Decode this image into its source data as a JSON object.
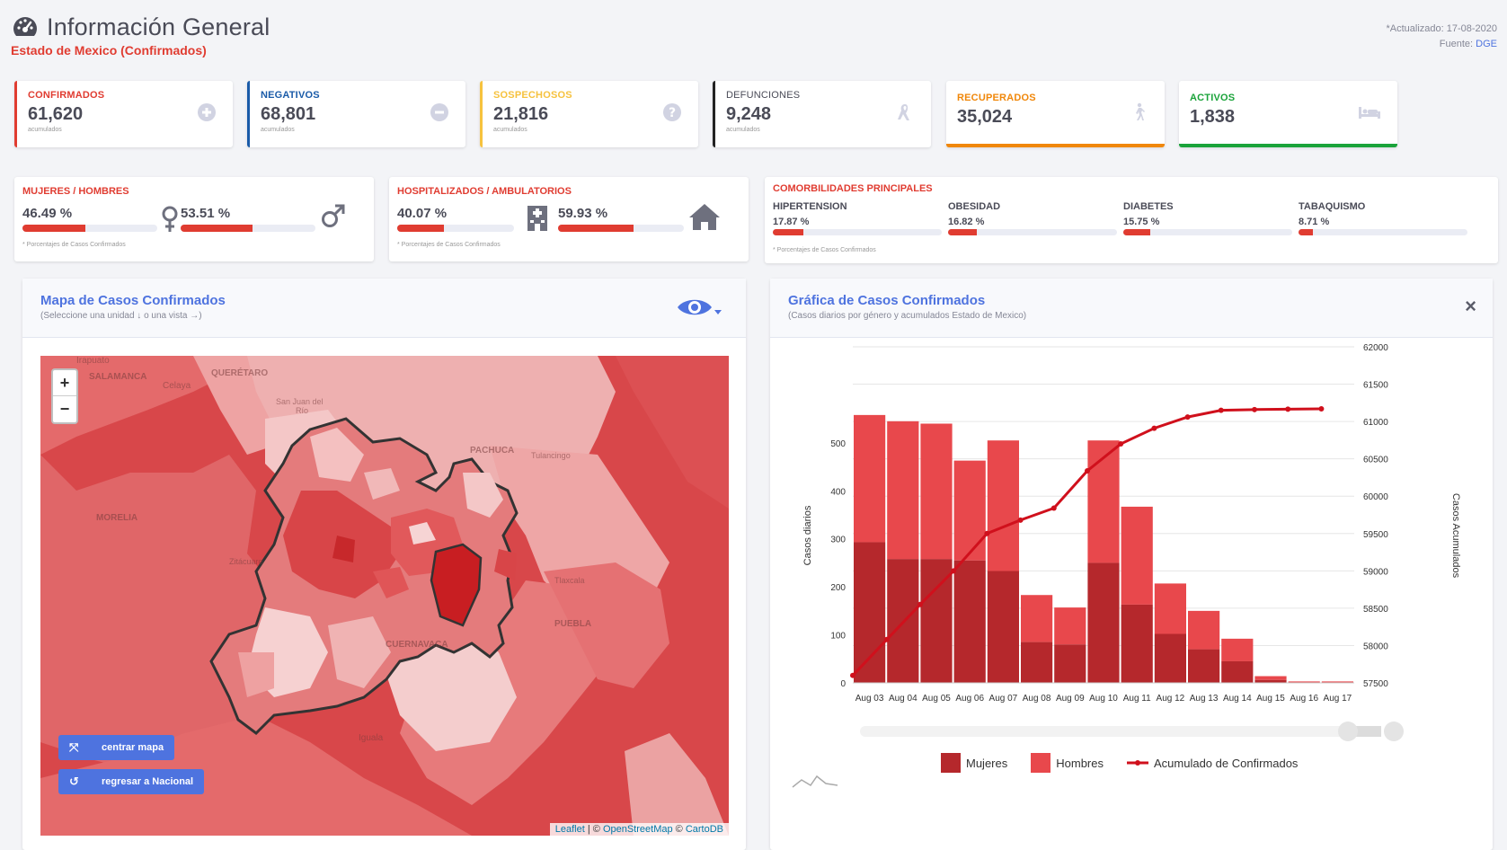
{
  "header": {
    "title": "Información General",
    "subtitle": "Estado de Mexico (Confirmados)",
    "updated": "*Actualizado: 17-08-2020",
    "source_label": "Fuente:",
    "source_value": "DGE"
  },
  "cards": [
    {
      "label": "CONFIRMADOS",
      "value": "61,620",
      "sub": "acumulados",
      "color": "#e03c31",
      "icon": "plus-circle-icon"
    },
    {
      "label": "NEGATIVOS",
      "value": "68,801",
      "sub": "acumulados",
      "color": "#1a5ba8",
      "icon": "minus-circle-icon"
    },
    {
      "label": "SOSPECHOSOS",
      "value": "21,816",
      "sub": "acumulados",
      "color": "#f6c23e",
      "icon": "question-circle-icon"
    },
    {
      "label": "DEFUNCIONES",
      "value": "9,248",
      "sub": "acumulados",
      "color": "#222222",
      "icon": "ribbon-icon"
    },
    {
      "label": "RECUPERADOS",
      "value": "35,024",
      "sub": "",
      "color": "#f0870a",
      "icon": "walking-icon"
    },
    {
      "label": "ACTIVOS",
      "value": "1,838",
      "sub": "",
      "color": "#1aa33a",
      "icon": "bed-icon"
    }
  ],
  "gender": {
    "label": "MUJERES / HOMBRES",
    "women_pct": "46.49 %",
    "women_fill": 0.4649,
    "men_pct": "53.51 %",
    "men_fill": 0.5351,
    "note": "* Porcentajes de Casos Confirmados"
  },
  "hosp": {
    "label": "HOSPITALIZADOS / AMBULATORIOS",
    "hosp_pct": "40.07 %",
    "hosp_fill": 0.4007,
    "amb_pct": "59.93 %",
    "amb_fill": 0.5993,
    "note": "* Porcentajes de Casos Confirmados"
  },
  "comorb": {
    "label": "COMORBILIDADES PRINCIPALES",
    "items": [
      {
        "name": "HIPERTENSION",
        "pct": "17.87 %",
        "fill": 0.1787
      },
      {
        "name": "OBESIDAD",
        "pct": "16.82 %",
        "fill": 0.1682
      },
      {
        "name": "DIABETES",
        "pct": "15.75 %",
        "fill": 0.1575
      },
      {
        "name": "TABAQUISMO",
        "pct": "8.71 %",
        "fill": 0.0871
      }
    ],
    "note": "* Porcentajes de Casos Confirmados"
  },
  "map_panel": {
    "title": "Mapa de Casos Confirmados",
    "subtitle": "(Seleccione una unidad ↓ o una vista →)",
    "zoom_in": "+",
    "zoom_out": "−",
    "center_btn": "centrar mapa",
    "back_btn": "regresar a Nacional",
    "attrib_leaflet": "Leaflet",
    "attrib_osm": "OpenStreetMap",
    "attrib_carto": "CartoDB",
    "attrib_sep1": " | © ",
    "attrib_sep2": " © ",
    "labels": {
      "irapuato": "Irapuato",
      "salamanca": "SALAMANCA",
      "celaya": "Celaya",
      "queretaro": "QUERÉTARO",
      "sanjuan1": "San Juan del",
      "sanjuan2": "Río",
      "pachuca": "PACHUCA",
      "tulancingo": "Tulancingo",
      "morelia": "MORELIA",
      "zitacuaro": "Zitácuaro",
      "tlaxcala": "Tlaxcala",
      "puebla": "PUEBLA",
      "cuernavaca": "CUERNAVACA",
      "iguala": "Iguala"
    }
  },
  "chart_panel": {
    "title": "Gráfica de Casos Confirmados",
    "subtitle": "(Casos diarios por género y acumulados Estado de Mexico)",
    "close": "×"
  },
  "colors": {
    "mujeres": "#b5282c",
    "hombres": "#e8484c",
    "line": "#d0101c",
    "accent": "#4e73df"
  },
  "chart_data": {
    "type": "bar",
    "categories": [
      "Aug 03",
      "Aug 04",
      "Aug 05",
      "Aug 06",
      "Aug 07",
      "Aug 08",
      "Aug 09",
      "Aug 10",
      "Aug 11",
      "Aug 12",
      "Aug 13",
      "Aug 14",
      "Aug 15",
      "Aug 16",
      "Aug 17"
    ],
    "series": [
      {
        "name": "Mujeres",
        "type": "bar",
        "stack": "a",
        "values": [
          293,
          258,
          258,
          255,
          233,
          85,
          80,
          250,
          163,
          102,
          70,
          45,
          6,
          1,
          1
        ]
      },
      {
        "name": "Hombres",
        "type": "bar",
        "stack": "a",
        "values": [
          265,
          287,
          282,
          208,
          272,
          98,
          77,
          255,
          204,
          105,
          80,
          47,
          8,
          2,
          2
        ]
      },
      {
        "name": "Acumulado de Confirmados",
        "type": "line",
        "axis": "right",
        "values": [
          57600,
          58080,
          58550,
          59000,
          59500,
          59680,
          59840,
          60340,
          60700,
          60910,
          61060,
          61150,
          61160,
          61165,
          61170
        ]
      }
    ],
    "ylabel": "Casos diarios",
    "y2label": "Casos Acumulados",
    "ylim": [
      0,
      700
    ],
    "yticks": [
      0,
      100,
      200,
      300,
      400,
      500
    ],
    "y2lim": [
      57500,
      62000
    ],
    "y2ticks": [
      57500,
      58000,
      58500,
      59000,
      59500,
      60000,
      60500,
      61000,
      61500,
      62000
    ],
    "legend": "bottom",
    "grid": true
  }
}
